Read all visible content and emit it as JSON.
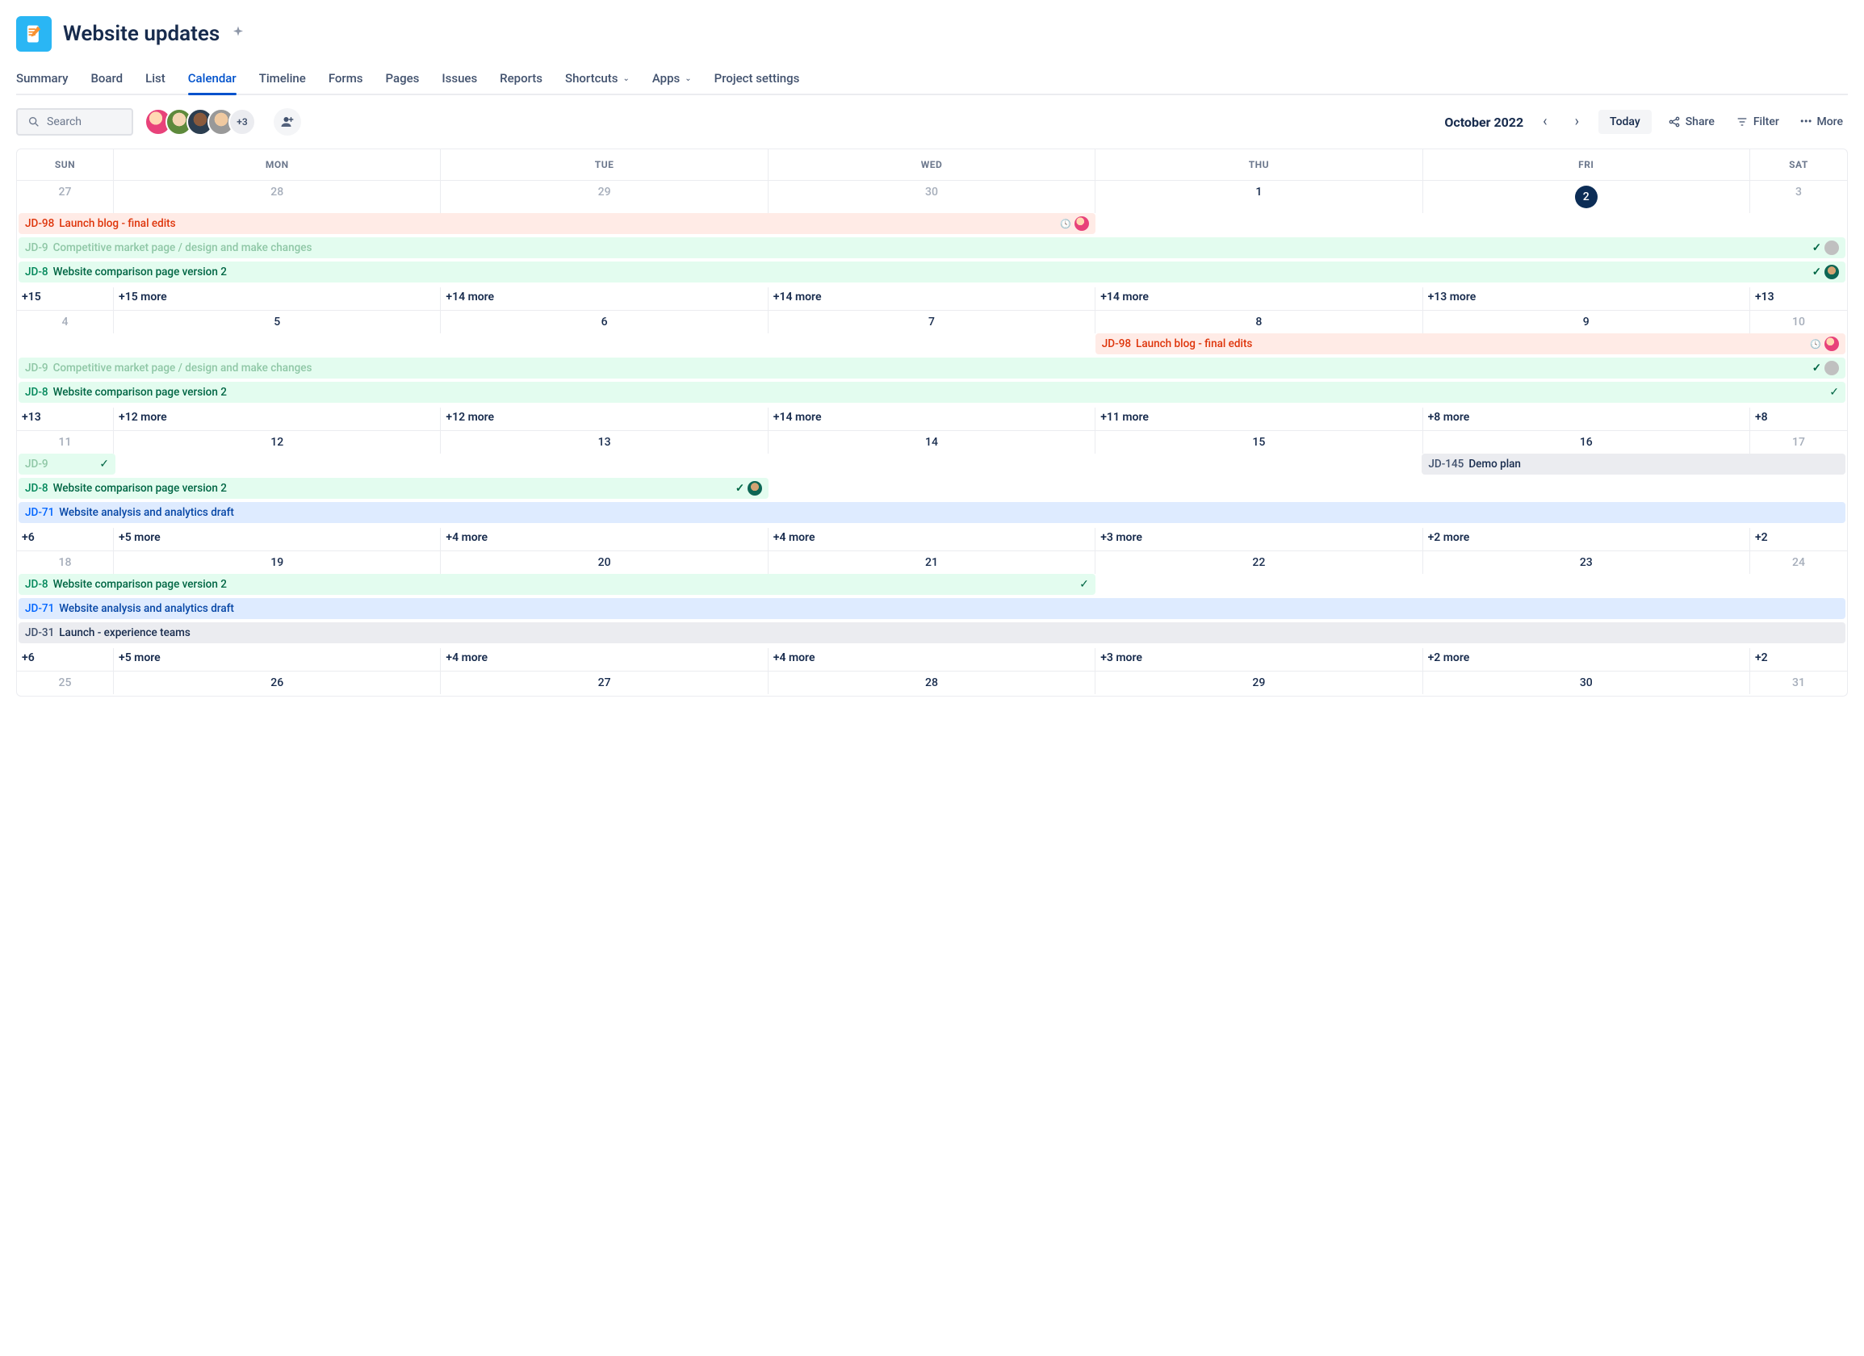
{
  "project": {
    "title": "Website updates"
  },
  "tabs": [
    "Summary",
    "Board",
    "List",
    "Calendar",
    "Timeline",
    "Forms",
    "Pages",
    "Issues",
    "Reports",
    "Shortcuts",
    "Apps",
    "Project settings"
  ],
  "activeTab": "Calendar",
  "dropdownTabs": [
    "Shortcuts",
    "Apps"
  ],
  "search": {
    "placeholder": "Search"
  },
  "avatarOverflow": "+3",
  "monthLabel": "October 2022",
  "toolbar": {
    "today": "Today",
    "share": "Share",
    "filter": "Filter",
    "more": "More"
  },
  "dayHeaders": [
    "SUN",
    "MON",
    "TUE",
    "WED",
    "THU",
    "FRI",
    "SAT"
  ],
  "weeks": [
    {
      "dates": [
        {
          "n": "27",
          "muted": true
        },
        {
          "n": "28",
          "muted": true
        },
        {
          "n": "29",
          "muted": true
        },
        {
          "n": "30",
          "muted": true
        },
        {
          "n": "1"
        },
        {
          "n": "2",
          "today": true
        },
        {
          "n": "3",
          "muted": true
        }
      ],
      "events": [
        {
          "start": 1,
          "span": 4,
          "cls": "ev-red-light",
          "key": "JD-98",
          "title": "Launch blog - final edits",
          "clock": true,
          "avatar": "av-1"
        },
        {
          "start": 1,
          "span": 7,
          "cls": "ev-green-faded",
          "key": "JD-9",
          "title": "Competitive market page / design and make changes",
          "check": true,
          "avatar": "av-6"
        },
        {
          "start": 1,
          "span": 7,
          "cls": "ev-green",
          "key": "JD-8",
          "title": "Website comparison page version 2",
          "check": true,
          "avatar": "av-5"
        }
      ],
      "more": [
        "+15",
        "+15 more",
        "+14 more",
        "+14 more",
        "+14 more",
        "+13 more",
        "+13"
      ]
    },
    {
      "dates": [
        {
          "n": "4",
          "muted": true
        },
        {
          "n": "5"
        },
        {
          "n": "6"
        },
        {
          "n": "7"
        },
        {
          "n": "8"
        },
        {
          "n": "9"
        },
        {
          "n": "10",
          "muted": true
        }
      ],
      "events": [
        {
          "start": 5,
          "span": 3,
          "cls": "ev-red-light",
          "key": "JD-98",
          "title": "Launch blog - final edits",
          "clock": true,
          "avatar": "av-1"
        },
        {
          "start": 1,
          "span": 7,
          "cls": "ev-green-faded",
          "key": "JD-9",
          "title": "Competitive market page / design and make changes",
          "check": true,
          "avatar": "av-6"
        },
        {
          "start": 1,
          "span": 7,
          "cls": "ev-green",
          "key": "JD-8",
          "title": "Website comparison page version 2",
          "check": true
        }
      ],
      "more": [
        "+13",
        "+12 more",
        "+12 more",
        "+14 more",
        "+11 more",
        "+8 more",
        "+8"
      ]
    },
    {
      "dates": [
        {
          "n": "11",
          "muted": true
        },
        {
          "n": "12"
        },
        {
          "n": "13"
        },
        {
          "n": "14"
        },
        {
          "n": "15"
        },
        {
          "n": "16"
        },
        {
          "n": "17",
          "muted": true
        }
      ],
      "events": [
        {
          "start": 1,
          "span": 1,
          "cls": "ev-green-faded",
          "key": "JD-9",
          "title": "",
          "check": true
        },
        {
          "start": 6,
          "span": 2,
          "cls": "ev-gray",
          "key": "JD-145",
          "title": "Demo plan",
          "sameRow": 0
        },
        {
          "start": 1,
          "span": 3,
          "cls": "ev-green",
          "key": "JD-8",
          "title": "Website comparison page version 2",
          "check": true,
          "avatar": "av-5"
        },
        {
          "start": 1,
          "span": 7,
          "cls": "ev-blue",
          "key": "JD-71",
          "title": "Website analysis and analytics draft"
        }
      ],
      "more": [
        "+6",
        "+5 more",
        "+4 more",
        "+4 more",
        "+3 more",
        "+2 more",
        "+2"
      ]
    },
    {
      "dates": [
        {
          "n": "18",
          "muted": true
        },
        {
          "n": "19"
        },
        {
          "n": "20"
        },
        {
          "n": "21"
        },
        {
          "n": "22"
        },
        {
          "n": "23"
        },
        {
          "n": "24",
          "muted": true
        }
      ],
      "events": [
        {
          "start": 1,
          "span": 4,
          "cls": "ev-green",
          "key": "JD-8",
          "title": "Website comparison page version 2",
          "check": true
        },
        {
          "start": 1,
          "span": 7,
          "cls": "ev-blue",
          "key": "JD-71",
          "title": "Website analysis and analytics draft"
        },
        {
          "start": 1,
          "span": 7,
          "cls": "ev-gray",
          "key": "JD-31",
          "title": "Launch - experience teams"
        }
      ],
      "more": [
        "+6",
        "+5 more",
        "+4 more",
        "+4 more",
        "+3 more",
        "+2 more",
        "+2"
      ]
    },
    {
      "dates": [
        {
          "n": "25",
          "muted": true
        },
        {
          "n": "26"
        },
        {
          "n": "27"
        },
        {
          "n": "28"
        },
        {
          "n": "29"
        },
        {
          "n": "30"
        },
        {
          "n": "31",
          "muted": true
        }
      ],
      "events": [],
      "more": []
    }
  ]
}
